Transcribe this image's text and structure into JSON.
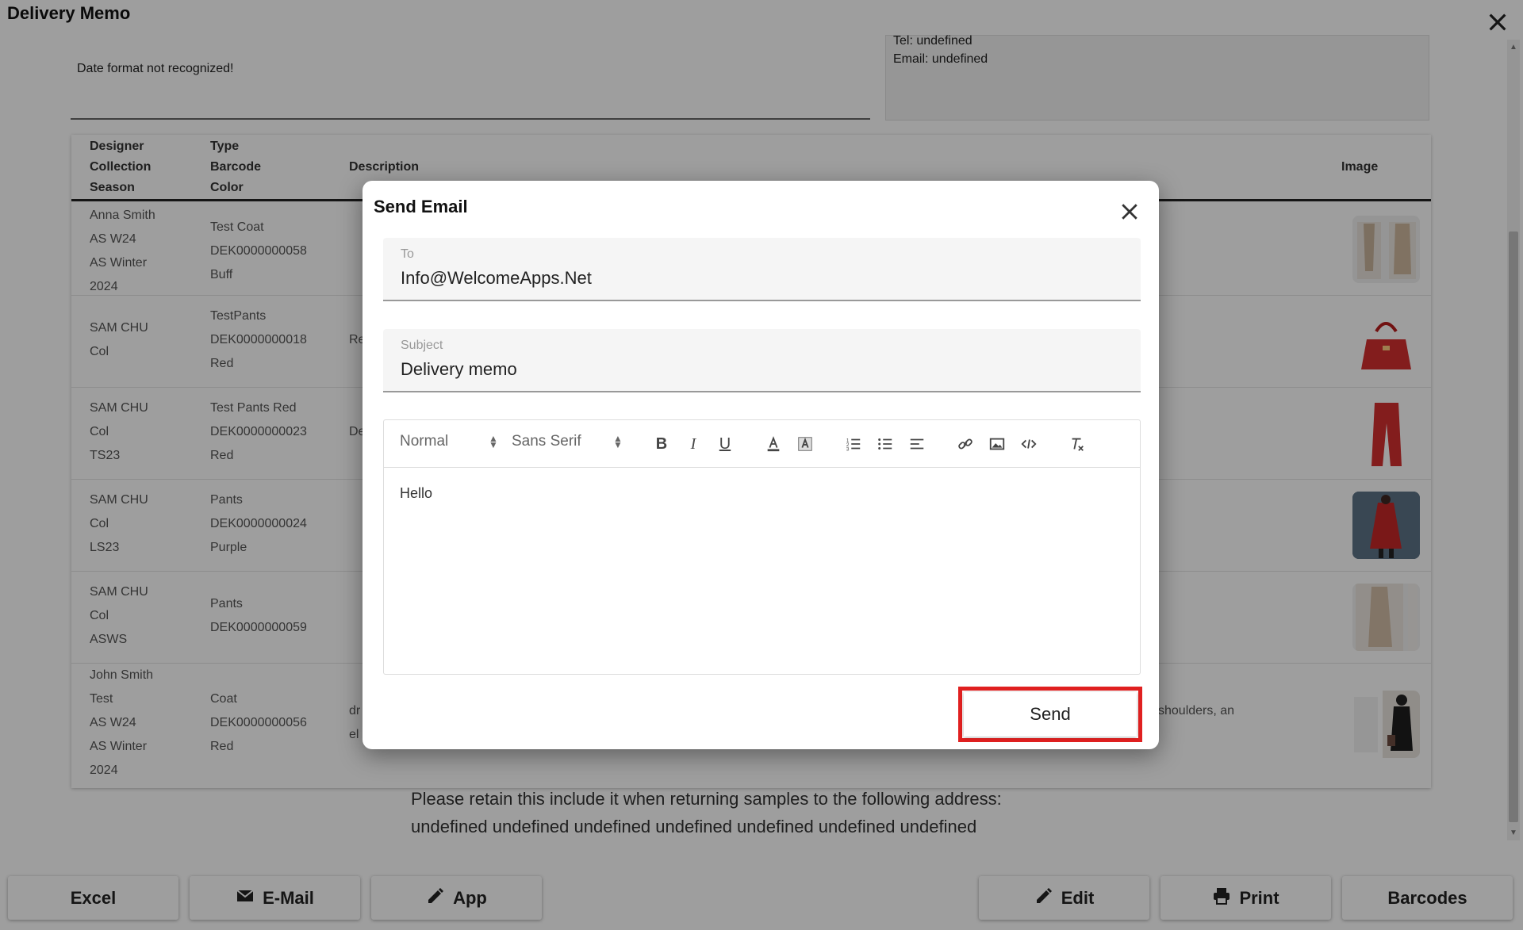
{
  "page": {
    "title": "Delivery Memo",
    "date_message": "Date format not recognized!",
    "contact": {
      "tel": "Tel: undefined",
      "email": "Email: undefined"
    },
    "table": {
      "headers": {
        "col1": [
          "Designer",
          "Collection",
          "Season"
        ],
        "col2": [
          "Type",
          "Barcode",
          "Color"
        ],
        "description": "Description",
        "image": "Image"
      },
      "rows": [
        {
          "col1": [
            "Anna Smith",
            "AS W24",
            "AS Winter",
            "2024"
          ],
          "col2": [
            "Test Coat",
            "DEK0000000058",
            "Buff"
          ],
          "description": "",
          "image_icon": "coat-photo-icon"
        },
        {
          "col1": [
            "SAM CHU",
            "Col"
          ],
          "col2": [
            "TestPants",
            "DEK0000000018",
            "Red"
          ],
          "description": "Re",
          "image_icon": "red-handbag-photo-icon"
        },
        {
          "col1": [
            "SAM CHU",
            "Col",
            "TS23"
          ],
          "col2": [
            "Test Pants Red",
            "DEK0000000023",
            "Red"
          ],
          "description": "De",
          "image_icon": "red-pants-photo-icon"
        },
        {
          "col1": [
            "SAM CHU",
            "Col",
            "LS23"
          ],
          "col2": [
            "Pants",
            "DEK0000000024",
            "Purple"
          ],
          "description": "",
          "image_icon": "red-coat-photo-icon"
        },
        {
          "col1": [
            "SAM CHU",
            "Col",
            "ASWS"
          ],
          "col2": [
            "Pants",
            "DEK0000000059"
          ],
          "description": "",
          "image_icon": "beige-dress-photo-icon"
        },
        {
          "col1": [
            "John Smith",
            "Test",
            "AS W24",
            "AS Winter",
            "2024"
          ],
          "col2": [
            "Coat",
            "DEK0000000056",
            "Red"
          ],
          "description": "dr",
          "description2": "el",
          "description_right": "shoulders, an",
          "image_icon": "black-outfit-photo-icon"
        }
      ]
    },
    "retain_text": [
      "Please retain this include it when returning samples to the following address:",
      "undefined undefined undefined undefined undefined undefined undefined"
    ],
    "buttons": {
      "excel": "Excel",
      "email": "E-Mail",
      "app": "App",
      "edit": "Edit",
      "print": "Print",
      "barcodes": "Barcodes"
    }
  },
  "dialog": {
    "title": "Send Email",
    "to": {
      "label": "To",
      "value": "Info@WelcomeApps.Net"
    },
    "subject": {
      "label": "Subject",
      "value": "Delivery memo"
    },
    "toolbar": {
      "header_select": "Normal",
      "font_select": "Sans Serif",
      "icons": [
        "bold-icon",
        "italic-icon",
        "underline-icon",
        "font-color-icon",
        "background-color-icon",
        "ordered-list-icon",
        "bullet-list-icon",
        "align-icon",
        "link-icon",
        "image-icon",
        "code-icon",
        "clear-format-icon"
      ]
    },
    "body_text": "Hello",
    "send_label": "Send",
    "highlight_color": "#e02020"
  }
}
